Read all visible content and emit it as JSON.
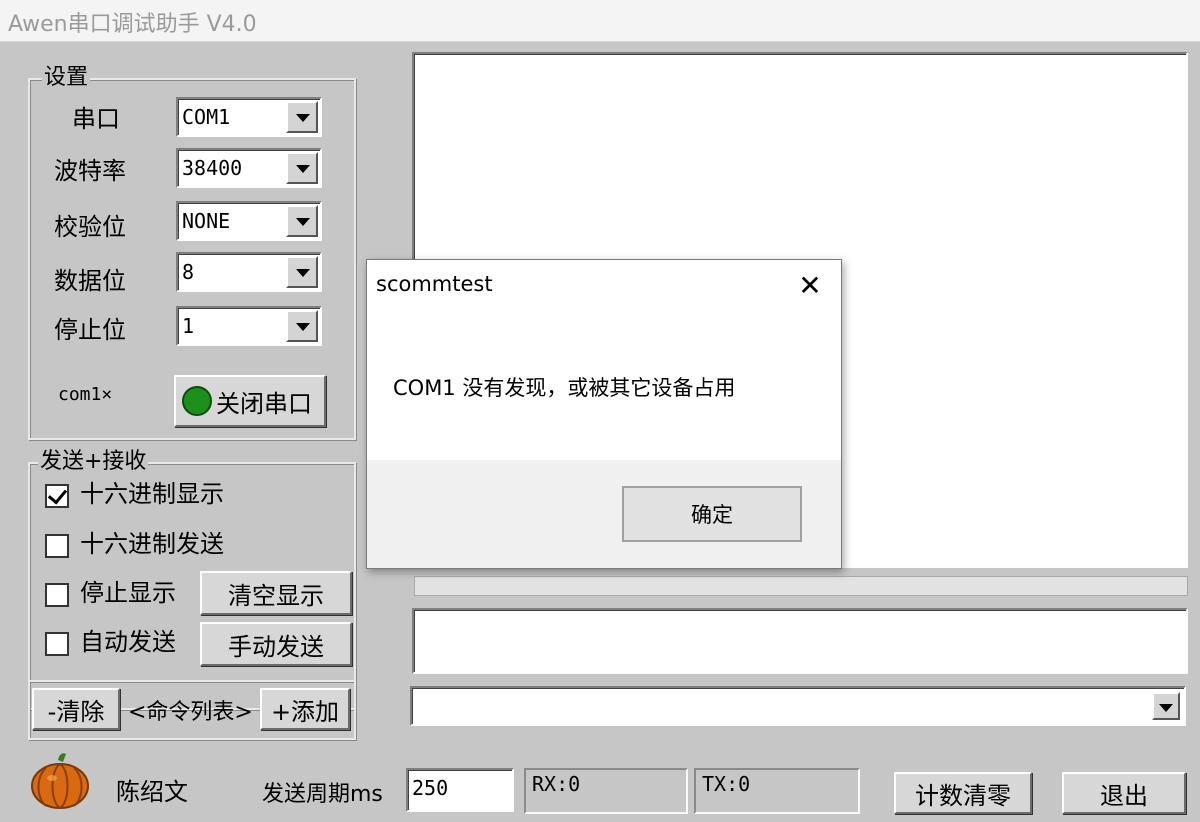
{
  "window": {
    "title": "Awen串口调试助手 V4.0"
  },
  "settings": {
    "legend": "设置",
    "port_label": "串口",
    "port_value": "COM1",
    "baud_label": "波特率",
    "baud_value": "38400",
    "parity_label": "校验位",
    "parity_value": "NONE",
    "databits_label": "数据位",
    "databits_value": "8",
    "stopbits_label": "停止位",
    "stopbits_value": "1",
    "status_text": "com1×",
    "close_port_label": "关闭串口",
    "indicator_color": "#1c8f1c"
  },
  "sendrecv": {
    "legend": "发送+接收",
    "hex_display_label": "十六进制显示",
    "hex_display_checked": true,
    "hex_send_label": "十六进制发送",
    "hex_send_checked": false,
    "stop_display_label": "停止显示",
    "stop_display_checked": false,
    "auto_send_label": "自动发送",
    "auto_send_checked": false,
    "clear_display_label": "清空显示",
    "manual_send_label": "手动发送"
  },
  "commands": {
    "clear_label": "-清除",
    "list_label": "<命令列表>",
    "add_label": "+添加"
  },
  "footer": {
    "author": "陈绍文",
    "period_label": "发送周期ms",
    "period_value": "250",
    "rx_label": "RX:0",
    "tx_label": "TX:0",
    "reset_count_label": "计数清零",
    "exit_label": "退出"
  },
  "dialog": {
    "title": "scommtest",
    "close_glyph": "✕",
    "message": "COM1 没有发现，或被其它设备占用",
    "ok_label": "确定"
  }
}
